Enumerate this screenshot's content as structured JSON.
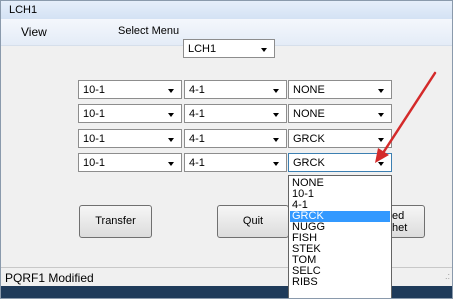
{
  "window": {
    "title": "LCH1"
  },
  "menu": {
    "view_label": "View",
    "select_label": "Select Menu",
    "select_value": "LCH1"
  },
  "rows": [
    {
      "col1": "10-1",
      "col2": "4-1",
      "col3": "NONE"
    },
    {
      "col1": "10-1",
      "col2": "4-1",
      "col3": "NONE"
    },
    {
      "col1": "10-1",
      "col2": "4-1",
      "col3": "GRCK"
    },
    {
      "col1": "10-1",
      "col2": "4-1",
      "col3": "GRCK"
    }
  ],
  "buttons": {
    "transfer": "Transfer",
    "quit": "Quit",
    "partial_right_top": "ed",
    "partial_right_bottom": "het"
  },
  "dropdown": {
    "options": [
      "NONE",
      "10-1",
      "4-1",
      "GRCK",
      "NUGG",
      "FISH",
      "STEK",
      "TOM",
      "SELC",
      "RIBS"
    ],
    "selected": "GRCK"
  },
  "status": {
    "text": "PQRF1  Modified",
    "grip": ".:"
  },
  "colors": {
    "selection": "#3399ff",
    "annotation_arrow": "#d42a2a",
    "titlebar": "#dce7f7"
  }
}
